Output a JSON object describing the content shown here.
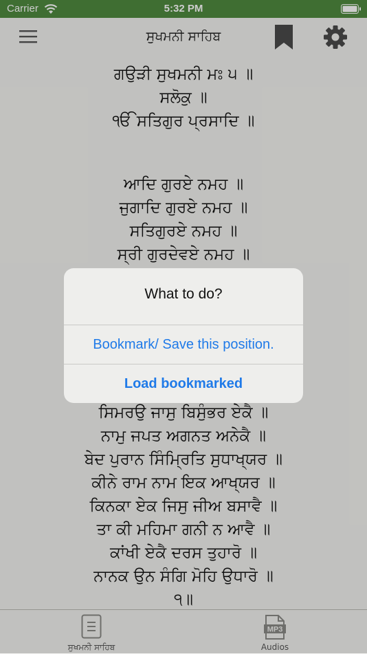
{
  "status_bar": {
    "carrier": "Carrier",
    "time": "5:32 PM"
  },
  "nav": {
    "title": "ਸੁਖਮਨੀ ਸਾਹਿਬ"
  },
  "verses": [
    "ਗਉੜੀ ਸੁਖਮਨੀ ਮਃ ੫ ॥",
    "ਸਲੋਕੁ ॥",
    "ੴ ਸਤਿਗੁਰ ਪ੍ਰਸਾਦਿ ॥",
    "ਆਦਿ ਗੁਰਏ ਨਮਹ ॥",
    "ਜੁਗਾਦਿ ਗੁਰਏ ਨਮਹ ॥",
    "ਸਤਿਗੁਰਏ ਨਮਹ ॥",
    "ਸ੍ਰੀ ਗੁਰਦੇਵਏ ਨਮਹ ॥",
    "ਸਿਮਰਉ ਜਾਸੁ ਬਿਸੁੰਭਰ ਏਕੈ ॥",
    "ਨਾਮੁ ਜਪਤ ਅਗਨਤ ਅਨੇਕੈ ॥",
    "ਬੇਦ ਪੁਰਾਨ ਸਿੰਮ੍ਰਿਤਿ ਸੁਧਾਖ੍ਯਰ ॥",
    "ਕੀਨੇ ਰਾਮ ਨਾਮ ਇਕ ਆਖ੍ਯਰ ॥",
    "ਕਿਨਕਾ ਏਕ ਜਿਸੁ ਜੀਅ ਬਸਾਵੈ ॥",
    "ਤਾ ਕੀ ਮਹਿਮਾ ਗਨੀ ਨ ਆਵੈ ॥",
    "ਕਾਂਖੀ ਏਕੈ ਦਰਸ ਤੁਹਾਰੋ ॥",
    "ਨਾਨਕ ਉਨ ਸੰਗਿ ਮੋਹਿ ਉਧਾਰੋ ॥",
    "੧॥"
  ],
  "alert": {
    "title": "What to do?",
    "actions": [
      "Bookmark/ Save this position.",
      "Load bookmarked"
    ]
  },
  "tabs": [
    {
      "label": "ਸੁਖਮਨੀ ਸਾਹਿਬ",
      "icon": "document-icon"
    },
    {
      "label": "Audios",
      "icon": "mp3-icon"
    }
  ],
  "colors": {
    "status_bar": "#4f8a3f",
    "accent": "#1f7ae8",
    "background": "#f2f2ef"
  }
}
